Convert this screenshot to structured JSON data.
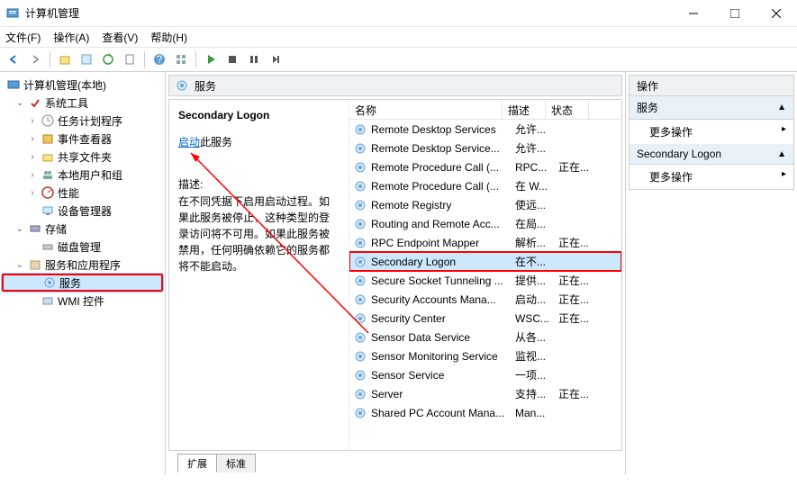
{
  "window": {
    "title": "计算机管理"
  },
  "menu": {
    "file": "文件(F)",
    "action": "操作(A)",
    "view": "查看(V)",
    "help": "帮助(H)"
  },
  "tree": {
    "root": "计算机管理(本地)",
    "system_tools": "系统工具",
    "task_scheduler": "任务计划程序",
    "event_viewer": "事件查看器",
    "shared_folders": "共享文件夹",
    "local_users": "本地用户和组",
    "performance": "性能",
    "device_manager": "设备管理器",
    "storage": "存储",
    "disk_mgmt": "磁盘管理",
    "services_apps": "服务和应用程序",
    "services": "服务",
    "wmi": "WMI 控件"
  },
  "svc_header": "服务",
  "detail": {
    "name": "Secondary Logon",
    "start_link": "启动",
    "start_suffix": "此服务",
    "desc_label": "描述:",
    "desc_text": "在不同凭据下启用启动过程。如果此服务被停止，这种类型的登录访问将不可用。如果此服务被禁用，任何明确依赖它的服务都将不能启动。"
  },
  "cols": {
    "name": "名称",
    "desc": "描述",
    "status": "状态"
  },
  "services": [
    {
      "name": "Remote Desktop Services",
      "desc": "允许...",
      "status": ""
    },
    {
      "name": "Remote Desktop Service...",
      "desc": "允许...",
      "status": ""
    },
    {
      "name": "Remote Procedure Call (...",
      "desc": "RPC...",
      "status": "正在..."
    },
    {
      "name": "Remote Procedure Call (...",
      "desc": "在 W...",
      "status": ""
    },
    {
      "name": "Remote Registry",
      "desc": "使远...",
      "status": ""
    },
    {
      "name": "Routing and Remote Acc...",
      "desc": "在局...",
      "status": ""
    },
    {
      "name": "RPC Endpoint Mapper",
      "desc": "解析...",
      "status": "正在..."
    },
    {
      "name": "Secondary Logon",
      "desc": "在不...",
      "status": "",
      "selected": true
    },
    {
      "name": "Secure Socket Tunneling ...",
      "desc": "提供...",
      "status": "正在..."
    },
    {
      "name": "Security Accounts Mana...",
      "desc": "启动...",
      "status": "正在..."
    },
    {
      "name": "Security Center",
      "desc": "WSC...",
      "status": "正在..."
    },
    {
      "name": "Sensor Data Service",
      "desc": "从各...",
      "status": ""
    },
    {
      "name": "Sensor Monitoring Service",
      "desc": "监视...",
      "status": ""
    },
    {
      "name": "Sensor Service",
      "desc": "一项...",
      "status": ""
    },
    {
      "name": "Server",
      "desc": "支持...",
      "status": "正在..."
    },
    {
      "name": "Shared PC Account Mana...",
      "desc": "Man...",
      "status": ""
    }
  ],
  "tabs": {
    "extended": "扩展",
    "standard": "标准"
  },
  "actions": {
    "header": "操作",
    "section1": "服务",
    "more1": "更多操作",
    "section2": "Secondary Logon",
    "more2": "更多操作"
  }
}
